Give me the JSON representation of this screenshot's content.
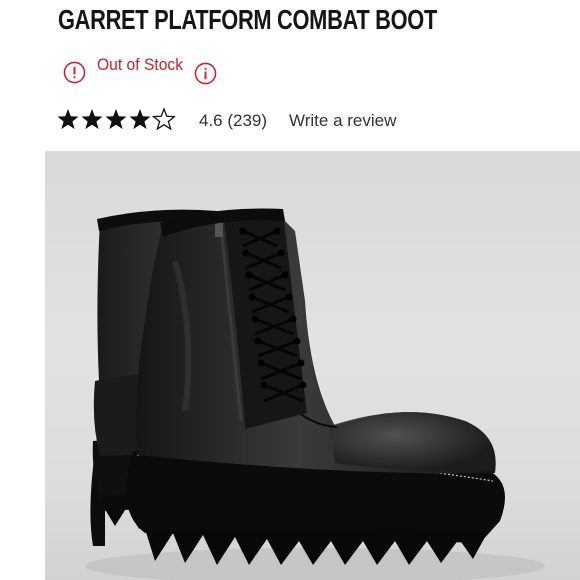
{
  "product": {
    "title": "GARRET PLATFORM COMBAT BOOT"
  },
  "stock": {
    "status_label": "Out of Stock",
    "status_color": "#cc1f2b",
    "alert_icon": "exclamation-circle-icon",
    "info_icon": "info-circle-icon"
  },
  "rating": {
    "stars_value": 4.6,
    "stars_max": 5,
    "summary": "4.6 (239)",
    "review_link": "Write a review"
  },
  "image": {
    "subject": "black-leather-lace-up-boot-pair"
  }
}
